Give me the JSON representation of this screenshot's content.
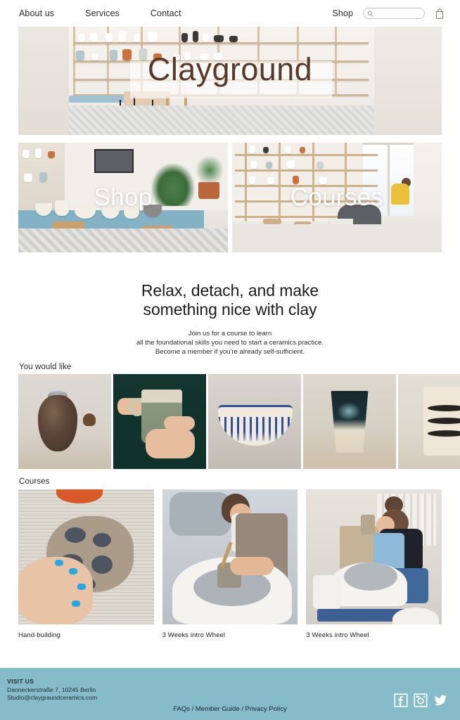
{
  "nav": {
    "links": [
      {
        "label": "About us",
        "name": "nav-link-about-us"
      },
      {
        "label": "Services",
        "name": "nav-link-services"
      },
      {
        "label": "Contact",
        "name": "nav-link-contact"
      }
    ],
    "shop_label": "Shop",
    "search": {
      "value": "",
      "placeholder": "",
      "icon": "search-icon"
    },
    "cart_icon": "shopping-bag-icon"
  },
  "hero": {
    "title": "Clayground"
  },
  "promo_cards": [
    {
      "label": "Shop",
      "name": "promo-card-shop"
    },
    {
      "label": "Courses",
      "name": "promo-card-courses"
    }
  ],
  "intro": {
    "headline_line1": "Relax, detach, and make",
    "headline_line2": "something nice with clay",
    "sub_line1": "Join us for a course to learn",
    "sub_line2": "all the foundational skills you need to start a ceramics practice.",
    "sub_line3": "Become a member if you're already self-sufficient."
  },
  "products": {
    "heading": "You would like",
    "items": [
      {
        "name": "product-tile-1"
      },
      {
        "name": "product-tile-2"
      },
      {
        "name": "product-tile-3"
      },
      {
        "name": "product-tile-4"
      },
      {
        "name": "product-tile-5"
      }
    ]
  },
  "courses": {
    "heading": "Courses",
    "items": [
      {
        "caption": "Hand-building"
      },
      {
        "caption": "3 Weeks intro Wheel"
      },
      {
        "caption": "3 Weeks intro Wheel"
      }
    ]
  },
  "footer": {
    "visit_us": "VISIT US",
    "address": "Danneckerstraße 7, 10245 Berlin",
    "email": "Studio@claygraundceramics.com",
    "links": "FAQs / Member Guide / Privacy Policy",
    "socials": [
      {
        "name": "facebook-icon"
      },
      {
        "name": "instagram-icon"
      },
      {
        "name": "twitter-icon"
      }
    ],
    "background_color": "#86bcca"
  },
  "colors": {
    "hero_title": "#56392b",
    "footer_bg": "#86bcca",
    "text": "#1c1c1c"
  }
}
